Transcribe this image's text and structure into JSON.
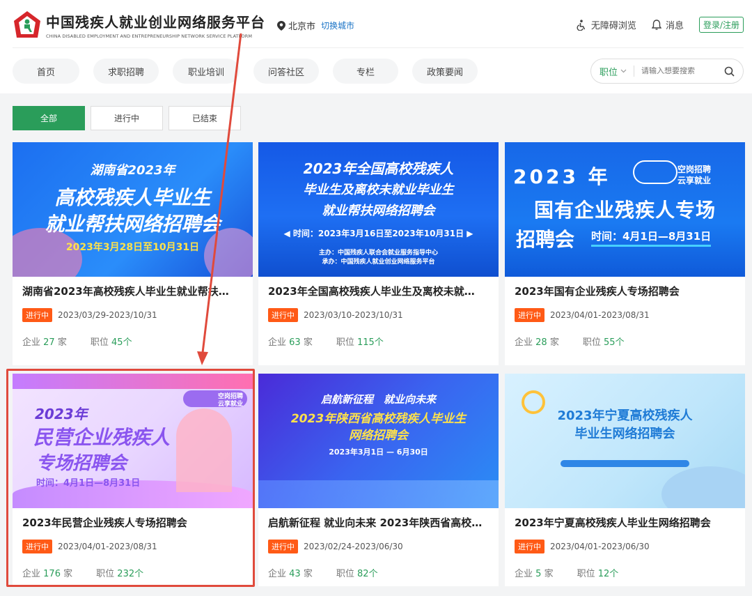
{
  "header": {
    "brand_cn": "中国残疾人就业创业网络服务平台",
    "brand_en": "CHINA DISABLED EMPLOYMENT AND ENTREPRENEURSHIP NETWORK SERVICE PLATFORM",
    "location": "北京市",
    "switch_city": "切换城市",
    "accessible": "无障碍浏览",
    "messages": "消息",
    "login": "登录/注册"
  },
  "nav": {
    "items": [
      "首页",
      "求职招聘",
      "职业培训",
      "问答社区",
      "专栏",
      "政策要闻"
    ]
  },
  "search": {
    "select": "职位",
    "placeholder": "请输入想要搜索"
  },
  "filters": [
    "全部",
    "进行中",
    "已结束"
  ],
  "colors": {
    "accent": "#2a9d5a",
    "badge": "#ff5a16",
    "highlight": "#e04a3c"
  },
  "cards": [
    {
      "banner": [
        "湖南省2023年",
        "高校残疾人毕业生",
        "就业帮扶网络招聘会",
        "2023年3月28日至10月31日"
      ],
      "title": "湖南省2023年高校残疾人毕业生就业帮扶…",
      "status": "进行中",
      "date": "2023/03/29-2023/10/31",
      "company_label": "企业",
      "company_count": "27",
      "company_unit": "家",
      "job_label": "职位",
      "job_count": "45",
      "job_unit": "个"
    },
    {
      "banner": [
        "2023年全国高校残疾人",
        "毕业生及离校未就业毕业生",
        "就业帮扶网络招聘会",
        "◀ 时间：2023年3月16日至2023年10月31日 ▶",
        "主办：中国残疾人联合会就业服务指导中心",
        "承办：中国残疾人就业创业网络服务平台"
      ],
      "title": "2023年全国高校残疾人毕业生及离校未就…",
      "status": "进行中",
      "date": "2023/03/10-2023/10/31",
      "company_label": "企业",
      "company_count": "63",
      "company_unit": "家",
      "job_label": "职位",
      "job_count": "115",
      "job_unit": "个"
    },
    {
      "banner": [
        "2023 年",
        "空岗招聘",
        "云享就业",
        "国有企业残疾人专场",
        "招聘会",
        "时间：4月1日—8月31日"
      ],
      "title": "2023年国有企业残疾人专场招聘会",
      "status": "进行中",
      "date": "2023/04/01-2023/08/31",
      "company_label": "企业",
      "company_count": "28",
      "company_unit": "家",
      "job_label": "职位",
      "job_count": "55",
      "job_unit": "个"
    },
    {
      "banner": [
        "2023年",
        "民营企业残疾人",
        "专场招聘会",
        "时间：4月1日—8月31日",
        "空岗招聘",
        "云享就业"
      ],
      "title": "2023年民营企业残疾人专场招聘会",
      "status": "进行中",
      "date": "2023/04/01-2023/08/31",
      "company_label": "企业",
      "company_count": "176",
      "company_unit": "家",
      "job_label": "职位",
      "job_count": "232",
      "job_unit": "个"
    },
    {
      "banner": [
        "启航新征程　就业向未来",
        "2023年陕西省高校残疾人毕业生",
        "网络招聘会",
        "2023年3月1日 — 6月30日"
      ],
      "title": "启航新征程 就业向未来 2023年陕西省高校…",
      "status": "进行中",
      "date": "2023/02/24-2023/06/30",
      "company_label": "企业",
      "company_count": "43",
      "company_unit": "家",
      "job_label": "职位",
      "job_count": "82",
      "job_unit": "个"
    },
    {
      "banner": [
        "2023年宁夏高校残疾人",
        "毕业生网络招聘会"
      ],
      "title": "2023年宁夏高校残疾人毕业生网络招聘会",
      "status": "进行中",
      "date": "2023/04/01-2023/06/30",
      "company_label": "企业",
      "company_count": "5",
      "company_unit": "家",
      "job_label": "职位",
      "job_count": "12",
      "job_unit": "个"
    }
  ]
}
